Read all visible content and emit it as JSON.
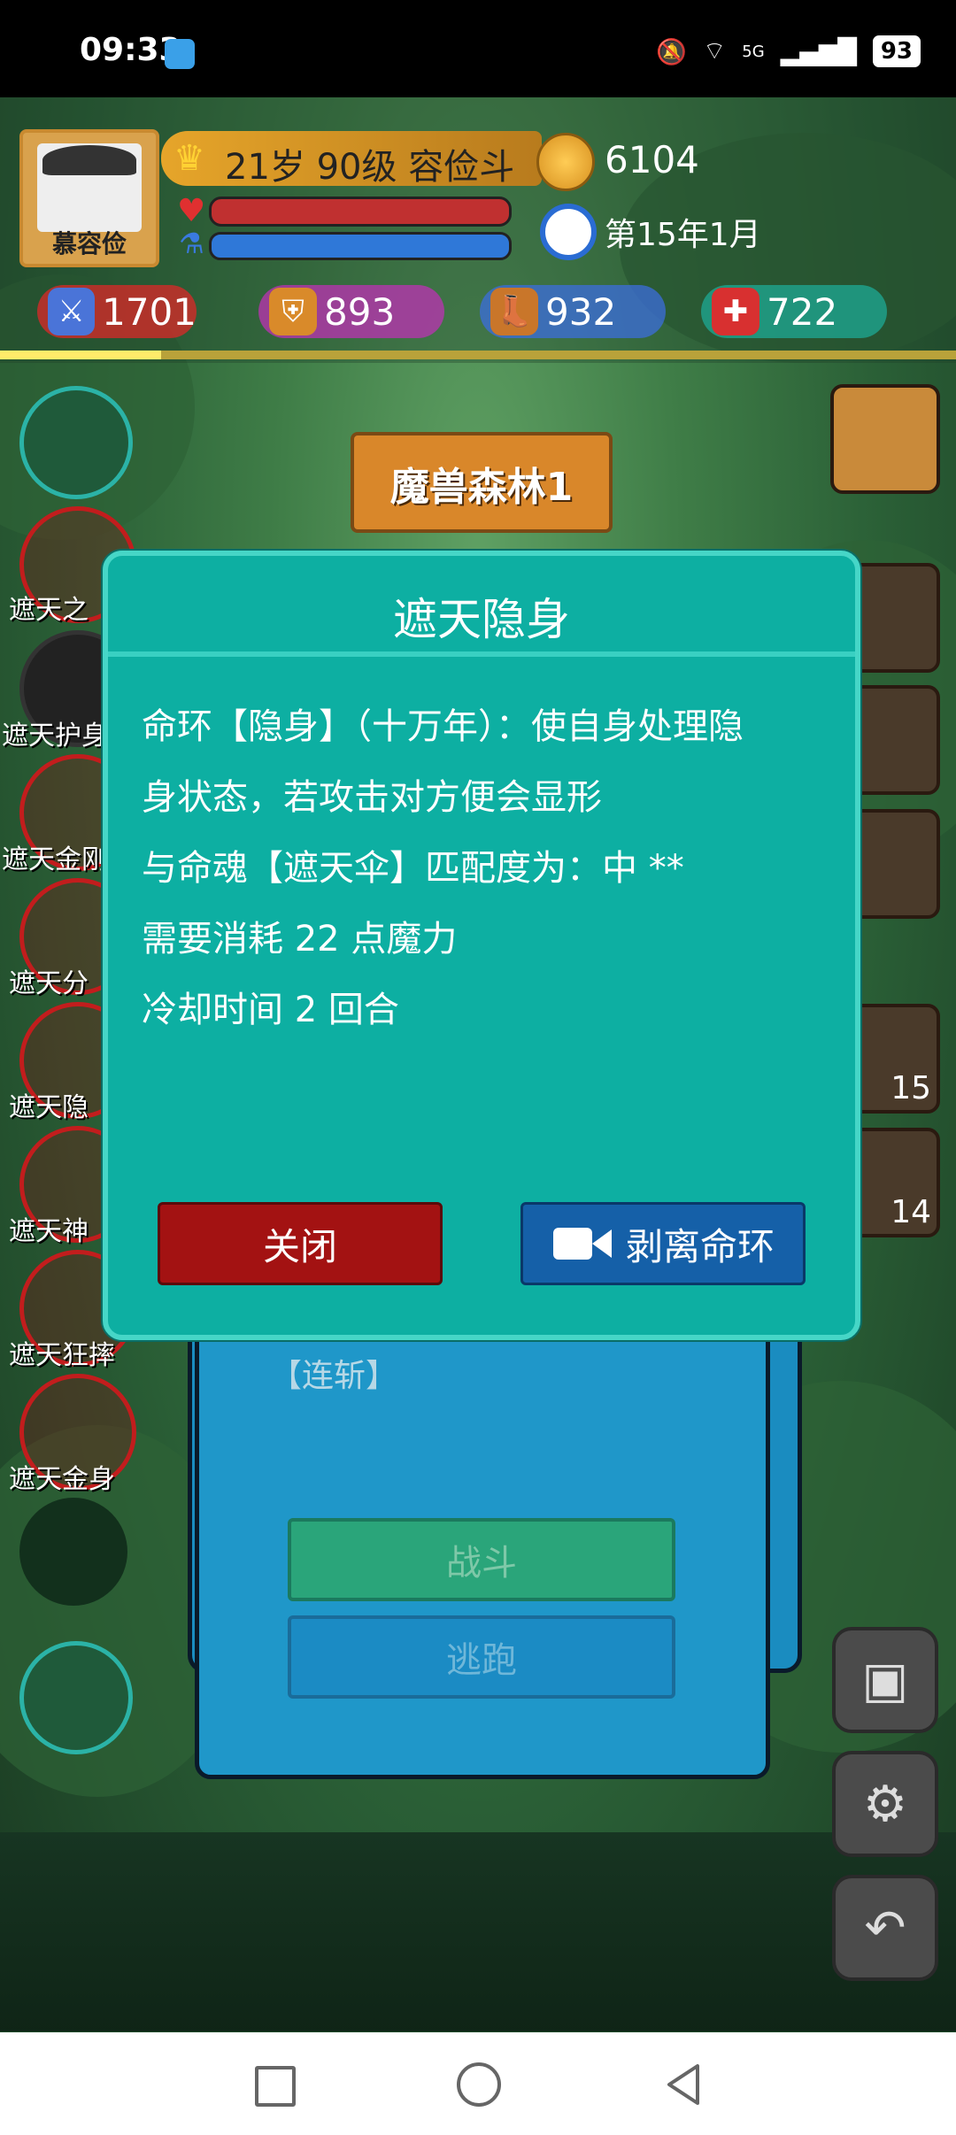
{
  "status_bar": {
    "time": "09:33",
    "network": "5G",
    "battery": "93"
  },
  "player": {
    "avatar_name": "慕容俭",
    "info": "21岁 90级 容俭斗",
    "gold": "6104",
    "date": "第15年1月"
  },
  "stats": {
    "attack": "1701",
    "defense": "893",
    "speed": "932",
    "health": "722"
  },
  "location": "魔兽森林1",
  "skills": [
    {
      "label": "遮天之"
    },
    {
      "label": "遮天护身"
    },
    {
      "label": "遮天金刚"
    },
    {
      "label": "遮天分"
    },
    {
      "label": "遮天隐"
    },
    {
      "label": "遮天神"
    },
    {
      "label": "遮天狂摔"
    },
    {
      "label": "遮天金身"
    }
  ],
  "items": {
    "potion_red_count": "15",
    "potion_blue_count": "14"
  },
  "battle_panel": {
    "skill_text": "【连斩】",
    "fight_label": "战斗",
    "flee_label": "逃跑"
  },
  "dialog": {
    "title": "遮天隐身",
    "lines": [
      "命环【隐身】（十万年）：使自身处理隐",
      "身状态，若攻击对方便会显形",
      "与命魂【遮天伞】匹配度为：中 **",
      "需要消耗 22 点魔力",
      "冷却时间 2 回合"
    ],
    "close_label": "关闭",
    "strip_label": "剥离命环"
  }
}
